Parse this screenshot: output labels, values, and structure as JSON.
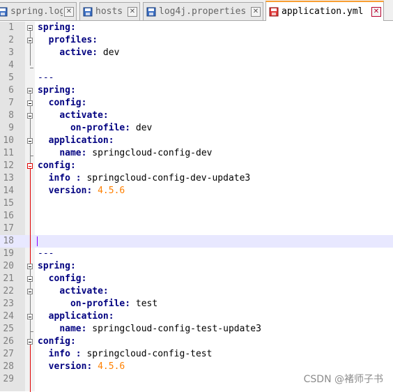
{
  "tabs": [
    {
      "label": "spring.log",
      "active": false,
      "icon": "disk-icon"
    },
    {
      "label": "hosts",
      "active": false,
      "icon": "disk-icon"
    },
    {
      "label": "log4j.properties",
      "active": false,
      "icon": "disk-icon"
    },
    {
      "label": "application.yml",
      "active": true,
      "icon": "disk-red-icon"
    }
  ],
  "close_glyph": "✕",
  "editor": {
    "lines": [
      {
        "n": "1",
        "ind": "",
        "key": "spring",
        "sep": ":",
        "val": "",
        "vtype": ""
      },
      {
        "n": "2",
        "ind": "  ",
        "key": "profiles",
        "sep": ":",
        "val": "",
        "vtype": ""
      },
      {
        "n": "3",
        "ind": "    ",
        "key": "active",
        "sep": ":",
        "val": " dev",
        "vtype": "v"
      },
      {
        "n": "4",
        "ind": "",
        "key": "",
        "sep": "",
        "val": "",
        "vtype": ""
      },
      {
        "n": "5",
        "ind": "",
        "key": "",
        "sep": "",
        "val": "---",
        "vtype": "d"
      },
      {
        "n": "6",
        "ind": "",
        "key": "spring",
        "sep": ":",
        "val": "",
        "vtype": ""
      },
      {
        "n": "7",
        "ind": "  ",
        "key": "config",
        "sep": ":",
        "val": "",
        "vtype": ""
      },
      {
        "n": "8",
        "ind": "    ",
        "key": "activate",
        "sep": ":",
        "val": "",
        "vtype": ""
      },
      {
        "n": "9",
        "ind": "      ",
        "key": "on-profile",
        "sep": ":",
        "val": " dev",
        "vtype": "v"
      },
      {
        "n": "10",
        "ind": "  ",
        "key": "application",
        "sep": ":",
        "val": "",
        "vtype": ""
      },
      {
        "n": "11",
        "ind": "    ",
        "key": "name",
        "sep": ":",
        "val": " springcloud-config-dev",
        "vtype": "v"
      },
      {
        "n": "12",
        "ind": "",
        "key": "config",
        "sep": ":",
        "val": "",
        "vtype": ""
      },
      {
        "n": "13",
        "ind": "  ",
        "key": "info",
        "sep": " :",
        "val": " springcloud-config-dev-update3",
        "vtype": "v"
      },
      {
        "n": "14",
        "ind": "  ",
        "key": "version",
        "sep": ":",
        "val": " 4.5.6",
        "vtype": "n"
      },
      {
        "n": "15",
        "ind": "",
        "key": "",
        "sep": "",
        "val": "",
        "vtype": ""
      },
      {
        "n": "16",
        "ind": "",
        "key": "",
        "sep": "",
        "val": "",
        "vtype": ""
      },
      {
        "n": "17",
        "ind": "",
        "key": "",
        "sep": "",
        "val": "",
        "vtype": ""
      },
      {
        "n": "18",
        "ind": "",
        "key": "",
        "sep": "",
        "val": "",
        "vtype": ""
      },
      {
        "n": "19",
        "ind": "",
        "key": "",
        "sep": "",
        "val": "---",
        "vtype": "d"
      },
      {
        "n": "20",
        "ind": "",
        "key": "spring",
        "sep": ":",
        "val": "",
        "vtype": ""
      },
      {
        "n": "21",
        "ind": "  ",
        "key": "config",
        "sep": ":",
        "val": "",
        "vtype": ""
      },
      {
        "n": "22",
        "ind": "    ",
        "key": "activate",
        "sep": ":",
        "val": "",
        "vtype": ""
      },
      {
        "n": "23",
        "ind": "      ",
        "key": "on-profile",
        "sep": ":",
        "val": " test",
        "vtype": "v"
      },
      {
        "n": "24",
        "ind": "  ",
        "key": "application",
        "sep": ":",
        "val": "",
        "vtype": ""
      },
      {
        "n": "25",
        "ind": "    ",
        "key": "name",
        "sep": ":",
        "val": " springcloud-config-test-update3",
        "vtype": "v"
      },
      {
        "n": "26",
        "ind": "",
        "key": "config",
        "sep": ":",
        "val": "",
        "vtype": ""
      },
      {
        "n": "27",
        "ind": "  ",
        "key": "info",
        "sep": " :",
        "val": " springcloud-config-test",
        "vtype": "v"
      },
      {
        "n": "28",
        "ind": "  ",
        "key": "version",
        "sep": ":",
        "val": " 4.5.6",
        "vtype": "n"
      },
      {
        "n": "29",
        "ind": "",
        "key": "",
        "sep": "",
        "val": "",
        "vtype": ""
      }
    ],
    "current_line": "18"
  },
  "watermark": "CSDN @褚师子书",
  "colors": {
    "keyword": "#000080",
    "number": "#ff8000",
    "caret": "#8000ff",
    "current_line_bg": "#e8e8ff",
    "active_tab_accent": "#f99e32"
  }
}
